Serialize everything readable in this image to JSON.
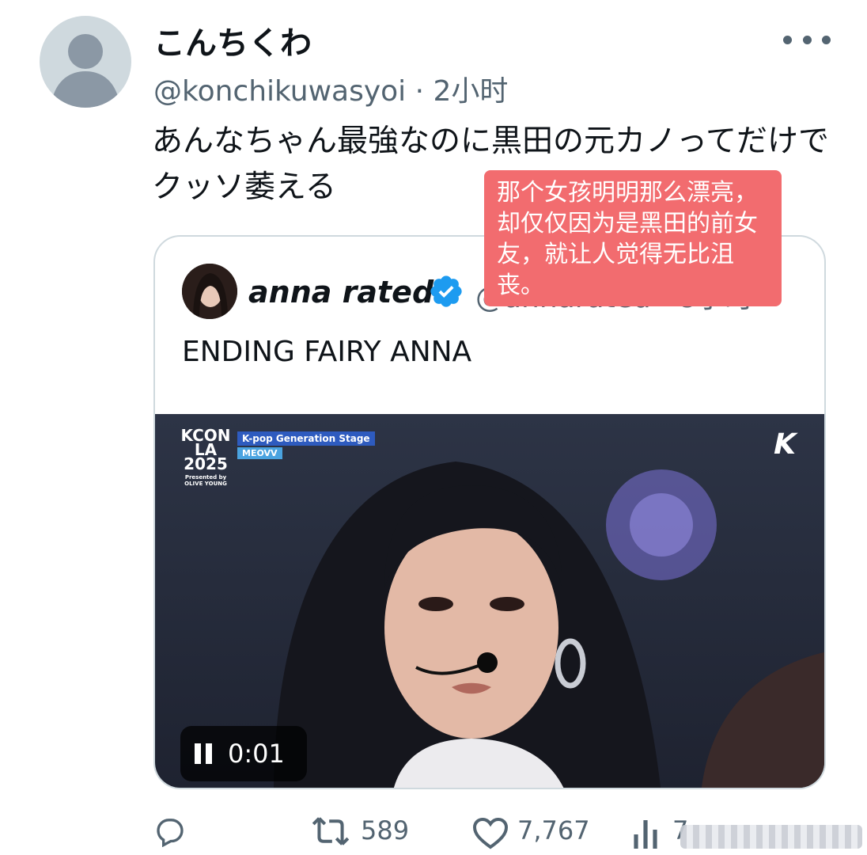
{
  "tweet": {
    "display_name": "こんちくわ",
    "handle": "@konchikuwasyoi",
    "time": "2小时",
    "text": "あんなちゃん最強なのに黒田の元カノってだけでクッソ萎える"
  },
  "quoted_tweet": {
    "display_name": "anna rated",
    "handle": "@annarated",
    "time": "8小时",
    "text": "ENDING FAIRY ANNA",
    "media": {
      "overlay_logo": "KCON",
      "overlay_logo_city": "LA",
      "overlay_logo_year": "2025",
      "overlay_logo_presenter": "Presented by OLIVE YOUNG",
      "stage_label": "K-pop Generation Stage",
      "stage_sublabel": "MEOVV",
      "corner_logo": "K",
      "video_time": "0:01"
    }
  },
  "translation_note": "那个女孩明明那么漂亮，却仅仅因为是黑田的前女友，就让人觉得无比沮丧。",
  "actions": {
    "retweets": "589",
    "likes": "7,767",
    "views": "7"
  },
  "icons": {
    "more": "more-horizontal-icon",
    "verified": "verified-badge-icon",
    "reply": "reply-icon",
    "retweet": "retweet-icon",
    "like": "heart-icon",
    "views": "views-icon",
    "pause": "pause-icon"
  },
  "colors": {
    "text_primary": "#0f1419",
    "text_secondary": "#536471",
    "verified": "#1d9bf0",
    "note_bg": "#f26c6f"
  }
}
